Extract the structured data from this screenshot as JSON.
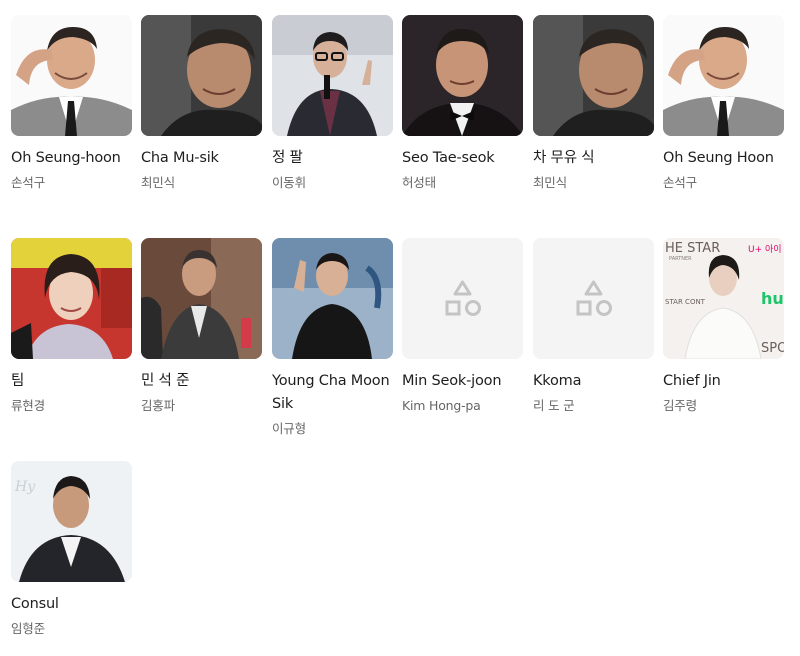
{
  "cast": [
    {
      "role": "Oh Seung-hoon",
      "actor": "손석구",
      "photo": "man-salute",
      "bg": "#ffffff"
    },
    {
      "role": "Cha Mu-sik",
      "actor": "최민식",
      "photo": "man-dark",
      "bg": "#3d3d3d"
    },
    {
      "role": "정 팔",
      "actor": "이동휘",
      "photo": "man-microphone",
      "bg": "#dcdfe3"
    },
    {
      "role": "Seo Tae-seok",
      "actor": "허성태",
      "photo": "man-bowtie",
      "bg": "#2a2226"
    },
    {
      "role": "차 무유 식",
      "actor": "최민식",
      "photo": "man-dark",
      "bg": "#3d3d3d"
    },
    {
      "role": "Oh Seung Hoon",
      "actor": "손석구",
      "photo": "man-salute",
      "bg": "#ffffff"
    },
    {
      "role": "팀",
      "actor": "류현경",
      "photo": "woman-red",
      "bg": "#c9352e"
    },
    {
      "role": "민 석 준",
      "actor": "김홍파",
      "photo": "man-suit-room",
      "bg": "#6b4a3a"
    },
    {
      "role": "Young Cha Moon Sik",
      "actor": "이규형",
      "photo": "man-wave",
      "bg": "#8fa8c3"
    },
    {
      "role": "Min Seok-joon",
      "actor": "Kim Hong-pa",
      "photo": "placeholder",
      "bg": "#f4f4f4"
    },
    {
      "role": "Kkoma",
      "actor": "리 도 군",
      "photo": "placeholder",
      "bg": "#f4f4f4"
    },
    {
      "role": "Chief Jin",
      "actor": "김주령",
      "photo": "woman-event",
      "bg": "#f3f0ee"
    },
    {
      "role": "Consul",
      "actor": "임형준",
      "photo": "man-suit-white",
      "bg": "#eef2f4"
    }
  ],
  "watermark": {
    "chief_jin_top": "HE STAR",
    "chief_jin_sub": "PARTNER",
    "chief_jin_right": "U+ 아이",
    "chief_jin_hu": "hu",
    "chief_jin_cont": "STAR CONT",
    "chief_jin_sp": "SPO",
    "consul_script": "Hy"
  },
  "colors": {
    "role_text": "#1e1e1e",
    "actor_text": "#666666",
    "placeholder_bg": "#f4f4f4",
    "placeholder_icon": "#c4c4c4"
  }
}
